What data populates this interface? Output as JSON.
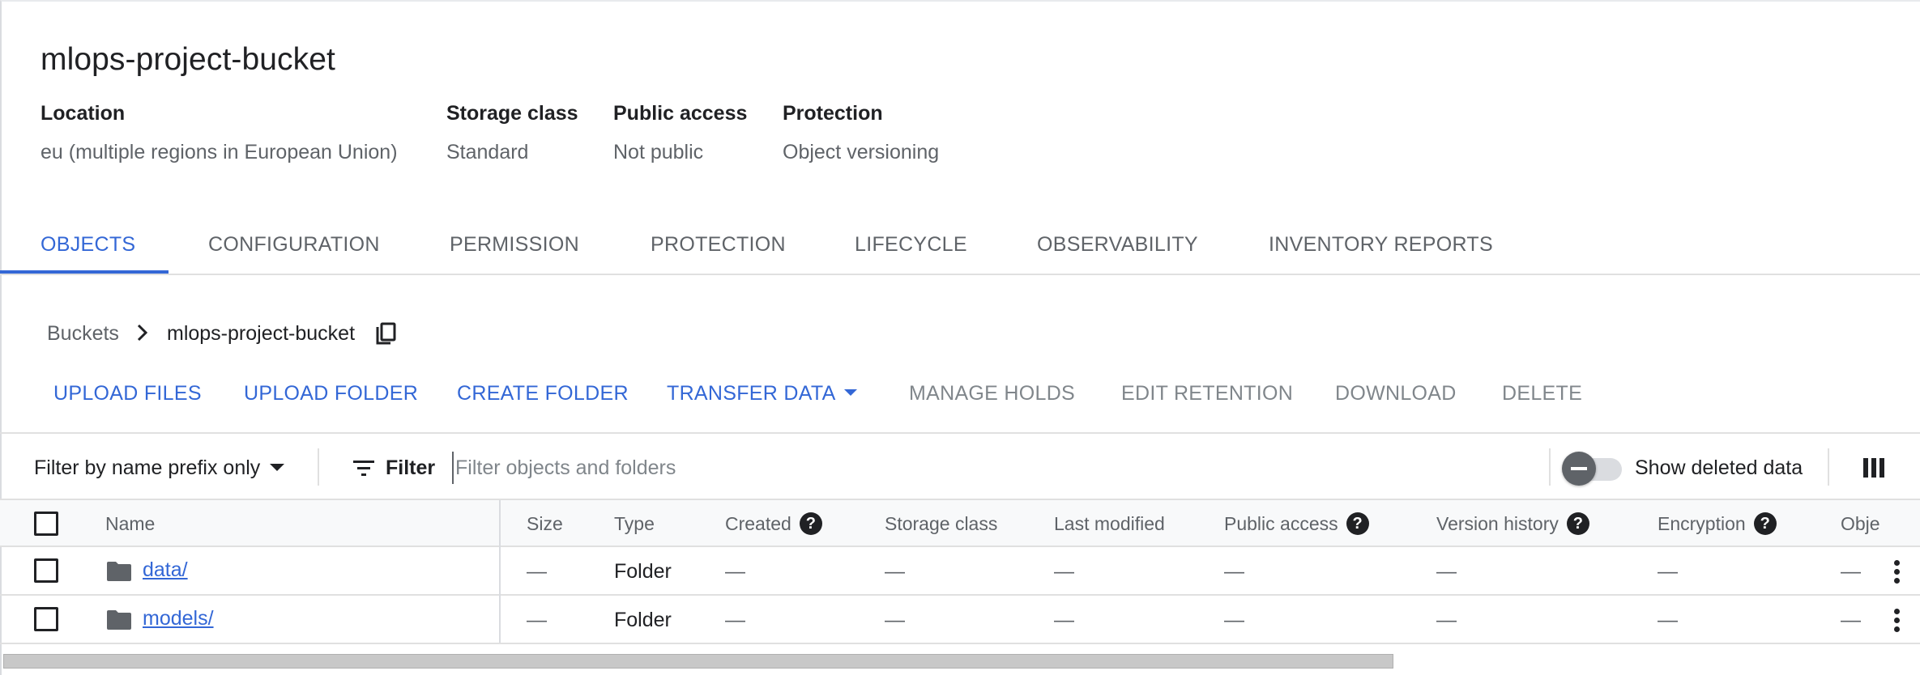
{
  "bucket": {
    "title": "mlops-project-bucket",
    "meta": [
      {
        "label": "Location",
        "value": "eu (multiple regions in European Union)"
      },
      {
        "label": "Storage class",
        "value": "Standard"
      },
      {
        "label": "Public access",
        "value": "Not public"
      },
      {
        "label": "Protection",
        "value": "Object versioning"
      }
    ]
  },
  "tabs": [
    {
      "label": "OBJECTS",
      "active": true
    },
    {
      "label": "CONFIGURATION"
    },
    {
      "label": "PERMISSION"
    },
    {
      "label": "PROTECTION"
    },
    {
      "label": "LIFECYCLE"
    },
    {
      "label": "OBSERVABILITY"
    },
    {
      "label": "INVENTORY REPORTS"
    }
  ],
  "breadcrumb": {
    "root": "Buckets",
    "current": "mlops-project-bucket"
  },
  "actions": [
    {
      "label": "UPLOAD FILES",
      "state": "enabled"
    },
    {
      "label": "UPLOAD FOLDER",
      "state": "enabled"
    },
    {
      "label": "CREATE FOLDER",
      "state": "enabled"
    },
    {
      "label": "TRANSFER DATA",
      "state": "enabled",
      "dropdown": true
    },
    {
      "label": "MANAGE HOLDS",
      "state": "disabled"
    },
    {
      "label": "EDIT RETENTION",
      "state": "disabled"
    },
    {
      "label": "DOWNLOAD",
      "state": "disabled"
    },
    {
      "label": "DELETE",
      "state": "disabled"
    }
  ],
  "filter": {
    "prefix_option": "Filter by name prefix only",
    "label": "Filter",
    "placeholder": "Filter objects and folders",
    "toggle_label": "Show deleted data",
    "toggle_on": false
  },
  "table": {
    "columns": [
      "Name",
      "Size",
      "Type",
      "Created",
      "Storage class",
      "Last modified",
      "Public access",
      "Version history",
      "Encryption",
      "Obje"
    ],
    "help_columns": [
      "Created",
      "Public access",
      "Version history",
      "Encryption"
    ],
    "rows": [
      {
        "name": "data/",
        "size": "—",
        "type": "Folder",
        "created": "—",
        "storage_class": "—",
        "last_modified": "—",
        "public_access": "—",
        "version_history": "—",
        "encryption": "—",
        "obje": "—"
      },
      {
        "name": "models/",
        "size": "—",
        "type": "Folder",
        "created": "—",
        "storage_class": "—",
        "last_modified": "—",
        "public_access": "—",
        "version_history": "—",
        "encryption": "—",
        "obje": "—"
      }
    ]
  },
  "colors": {
    "accent": "#3367d6",
    "disabled_text": "#80868b",
    "muted_text": "#5f6368"
  },
  "icons": [
    "chevron-right-icon",
    "copy-icon",
    "caret-down-icon",
    "filter-icon",
    "column-display-icon",
    "help-icon",
    "folder-icon",
    "more-vert-icon"
  ]
}
